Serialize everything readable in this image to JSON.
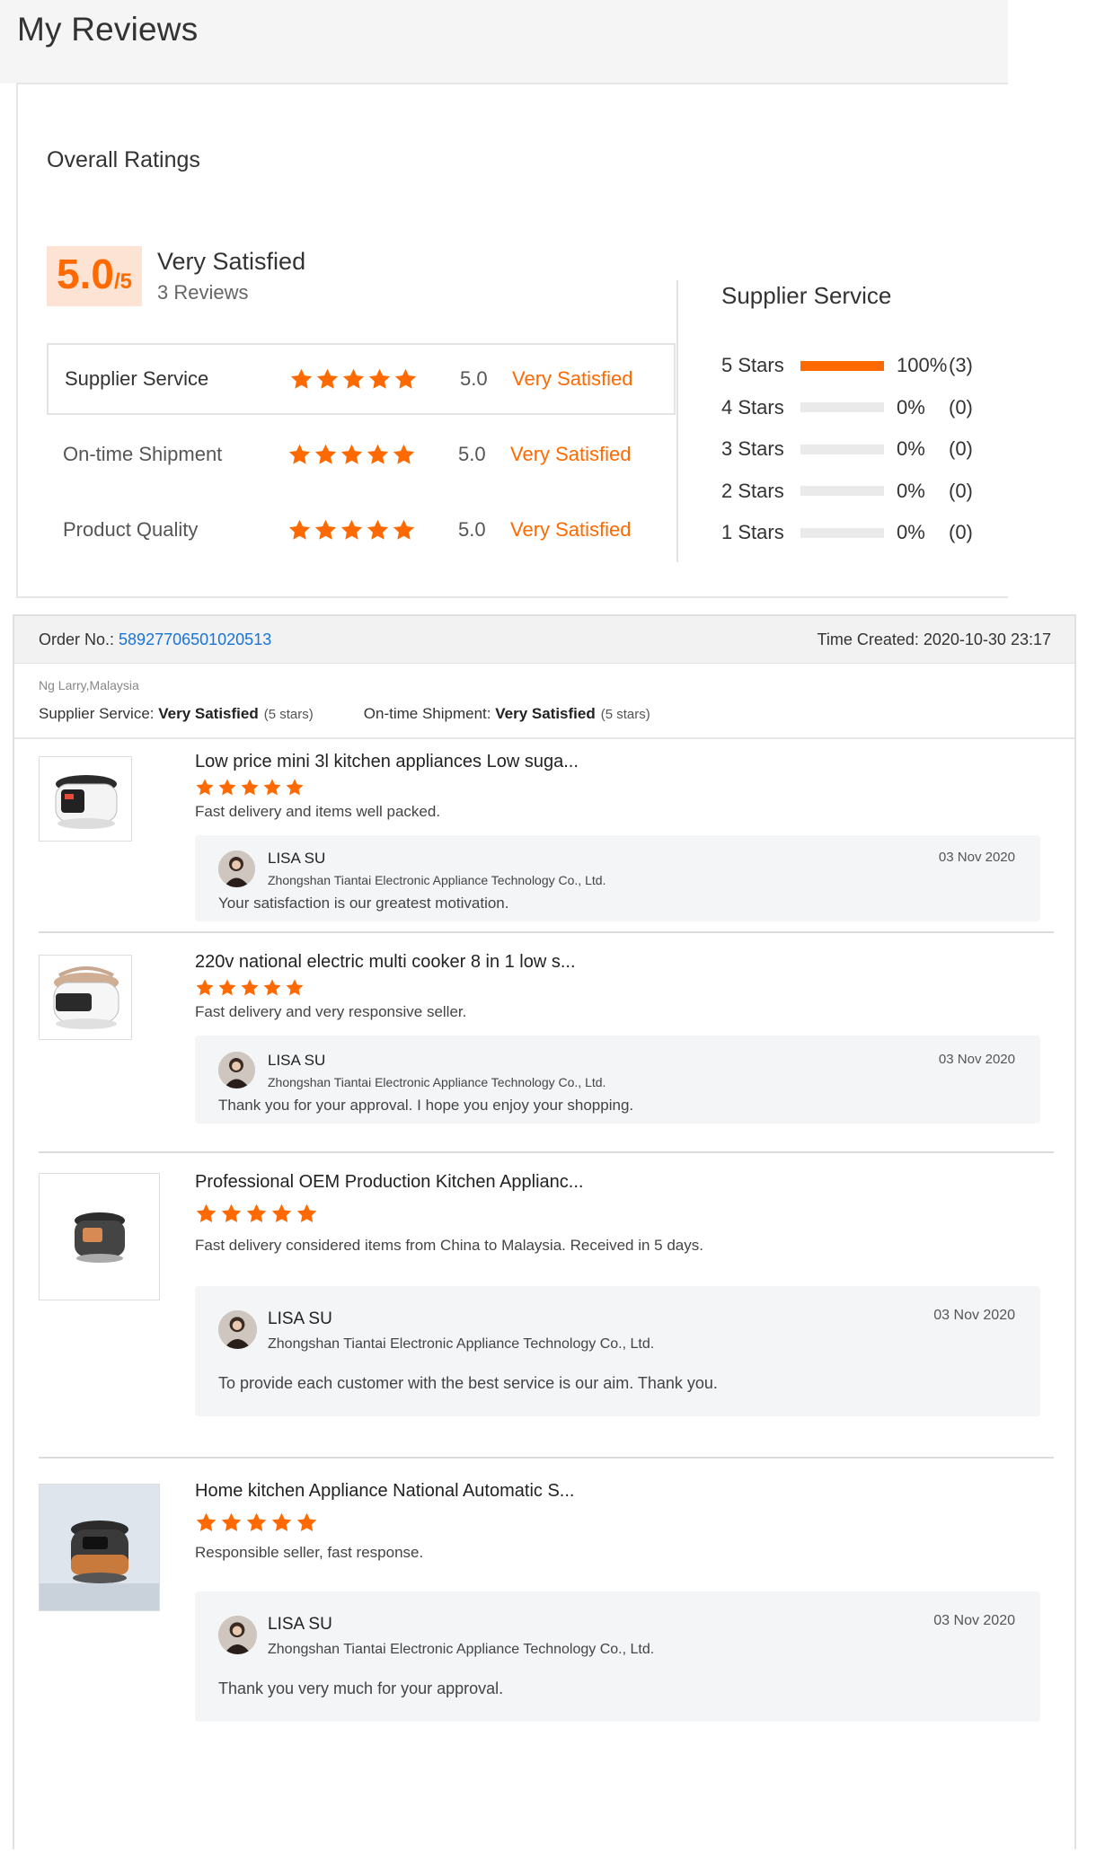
{
  "page": {
    "title": "My Reviews"
  },
  "overall": {
    "heading": "Overall Ratings",
    "score": "5.0",
    "score_max": "/5",
    "score_label": "Very Satisfied",
    "review_count": "3 Reviews",
    "rows": [
      {
        "label": "Supplier Service",
        "score": "5.0",
        "text": "Very Satisfied",
        "stars": 5
      },
      {
        "label": "On-time Shipment",
        "score": "5.0",
        "text": "Very Satisfied",
        "stars": 5
      },
      {
        "label": "Product Quality",
        "score": "5.0",
        "text": "Very Satisfied",
        "stars": 5
      }
    ]
  },
  "breakdown": {
    "title": "Supplier Service",
    "rows": [
      {
        "label": "5  Stars",
        "fraction": 1.0,
        "percent": "100%",
        "count": "(3)"
      },
      {
        "label": "4  Stars",
        "fraction": 0.0,
        "percent": "0%",
        "count": "(0)"
      },
      {
        "label": "3  Stars",
        "fraction": 0.0,
        "percent": "0%",
        "count": "(0)"
      },
      {
        "label": "2  Stars",
        "fraction": 0.0,
        "percent": "0%",
        "count": "(0)"
      },
      {
        "label": "1  Stars",
        "fraction": 0.0,
        "percent": "0%",
        "count": "(0)"
      }
    ]
  },
  "order": {
    "no_label": "Order No.: ",
    "no_value": "58927706501020513",
    "time_created": "Time Created: 2020-10-30 23:17",
    "buyer": "Ng Larry,Malaysia",
    "supplier_service_label": "Supplier Service: ",
    "supplier_service_value": "Very Satisfied",
    "supplier_service_note": "(5 stars)",
    "shipment_label": "On-time Shipment: ",
    "shipment_value": "Very Satisfied",
    "shipment_note": "(5 stars)"
  },
  "reviews": [
    {
      "title": "Low price mini 3l kitchen appliances Low suga...",
      "stars": 5,
      "comment": "Fast delivery and items well packed.",
      "reply": {
        "name": "LISA SU",
        "company": "Zhongshan Tiantai Electronic Appliance Technology Co., Ltd.",
        "date": "03 Nov 2020",
        "text": "Your satisfaction is our greatest motivation."
      }
    },
    {
      "title": "220v national electric multi cooker 8 in 1 low s...",
      "stars": 5,
      "comment": "Fast delivery and very responsive seller.",
      "reply": {
        "name": "LISA SU",
        "company": "Zhongshan Tiantai Electronic Appliance Technology Co., Ltd.",
        "date": "03 Nov 2020",
        "text": "Thank you for your approval. I hope you enjoy your shopping."
      }
    },
    {
      "title": "Professional OEM Production Kitchen Applianc...",
      "stars": 5,
      "comment": "Fast delivery considered items from China to Malaysia. Received in 5 days.",
      "reply": {
        "name": "LISA SU",
        "company": "Zhongshan Tiantai Electronic Appliance Technology Co., Ltd.",
        "date": "03 Nov 2020",
        "text": "To provide each customer with the best service is our aim. Thank you."
      }
    },
    {
      "title": "Home kitchen Appliance National Automatic S...",
      "stars": 5,
      "comment": "Responsible seller, fast response.",
      "reply": {
        "name": "LISA SU",
        "company": "Zhongshan Tiantai Electronic Appliance Technology Co., Ltd.",
        "date": "03 Nov 2020",
        "text": "Thank you very much for your approval."
      }
    }
  ],
  "colors": {
    "accent": "#ff6a00",
    "link": "#1a73d9",
    "score_bg": "#fde3d3"
  }
}
